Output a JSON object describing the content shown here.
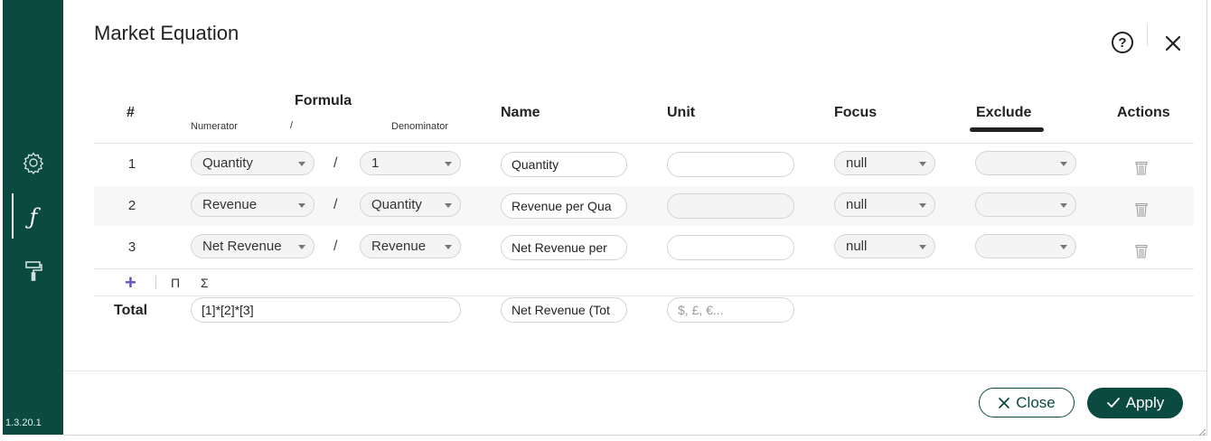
{
  "app": {
    "version": "1.3.20.1"
  },
  "sidebar": {
    "items": [
      {
        "icon": "gear-icon"
      },
      {
        "icon": "function-icon",
        "glyph": "ƒ",
        "active": true
      },
      {
        "icon": "paint-roller-icon"
      }
    ]
  },
  "dialog": {
    "title": "Market Equation",
    "help_glyph": "?"
  },
  "table": {
    "headers": {
      "number": "#",
      "formula": "Formula",
      "numerator": "Numerator",
      "divider": "/",
      "denominator": "Denominator",
      "name": "Name",
      "unit": "Unit",
      "focus": "Focus",
      "exclude": "Exclude",
      "actions": "Actions"
    },
    "rows": [
      {
        "num": "1",
        "numerator": "Quantity",
        "slash": "/",
        "denominator": "1",
        "name": "Quantity",
        "unit": "",
        "focus": "null",
        "exclude": ""
      },
      {
        "num": "2",
        "numerator": "Revenue",
        "slash": "/",
        "denominator": "Quantity",
        "name": "Revenue per Qua",
        "unit": "",
        "focus": "null",
        "exclude": ""
      },
      {
        "num": "3",
        "numerator": "Net Revenue",
        "slash": "/",
        "denominator": "Revenue",
        "name": "Net Revenue per",
        "unit": "",
        "focus": "null",
        "exclude": ""
      }
    ]
  },
  "toolbar": {
    "add": "+",
    "product": "Π",
    "sum": "Σ"
  },
  "total": {
    "label": "Total",
    "formula": "[1]*[2]*[3]",
    "name": "Net Revenue (Tot",
    "unit_placeholder": "$, £, €..."
  },
  "footer": {
    "close_label": "Close",
    "apply_label": "Apply"
  },
  "colors": {
    "brand": "#0b4a40",
    "accent": "#6b4fc8"
  }
}
